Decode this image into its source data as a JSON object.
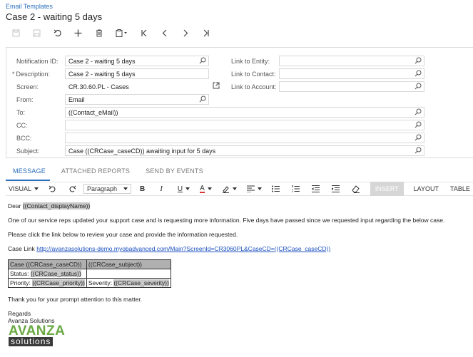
{
  "breadcrumb": "Email Templates",
  "title": "Case 2 - waiting 5 days",
  "form": {
    "notification_id": {
      "label": "Notification ID:",
      "value": "Case 2 - waiting 5 days"
    },
    "description": {
      "required_mark": "*",
      "label": "Description:",
      "value": "Case 2 - waiting 5 days"
    },
    "screen": {
      "label": "Screen:",
      "value": "CR.30.60.PL - Cases"
    },
    "from": {
      "label": "From:",
      "value": "Email"
    },
    "to": {
      "label": "To:",
      "value": "((Contact_eMail))"
    },
    "cc": {
      "label": "CC:",
      "value": ""
    },
    "bcc": {
      "label": "BCC:",
      "value": ""
    },
    "subject": {
      "label": "Subject:",
      "value": "Case ((CRCase_caseCD)) awaiting input for 5 days"
    },
    "link_entity": {
      "label": "Link to Entity:",
      "value": ""
    },
    "link_contact": {
      "label": "Link to Contact:",
      "value": ""
    },
    "link_account": {
      "label": "Link to Account:",
      "value": ""
    }
  },
  "tabs": [
    "MESSAGE",
    "ATTACHED REPORTS",
    "SEND BY EVENTS"
  ],
  "editor": {
    "visual": "VISUAL",
    "paragraph": "Paragraph",
    "insert": "INSERT",
    "layout": "LAYOUT",
    "table": "TABLE"
  },
  "message": {
    "greeting": "Dear",
    "greeting_field": "((Contact_displayName))",
    "para1": "One of our service reps updated your support case and is requesting more information. Five days have passed since we requested input regarding the below case.",
    "para2": "Please click the link below to review your case and provide the information requested.",
    "case_link_label": "Case Link",
    "case_link_url": "http://avanzasolutions-demo.myobadvanced.com/Main?ScreenId=CR3060PL&CaseCD=((CRCase_caseCD))",
    "table": {
      "r1c1_prefix": "Case",
      "r1c1_field": "((CRCase_caseCD))",
      "r1c2_field": "((CRCase_subject))",
      "r2c1_prefix": "Status:",
      "r2c1_field": "((CRCase_status))",
      "r3c1_prefix": "Priority:",
      "r3c1_field": "((CRCase_priority))",
      "r3c2_prefix": "Severity:",
      "r3c2_field": "((CRCase_severity))"
    },
    "thanks": "Thank you for your prompt attention to this matter.",
    "regards": "Regards",
    "company": "Avanza Solutions",
    "logo_line1": "AVANZA",
    "logo_line2": "solutions"
  },
  "colors": {
    "accent": "#2a6ebb",
    "link": "#1a4fbf",
    "template_field": "#c8c8c8",
    "logo_green": "#6aa842"
  }
}
